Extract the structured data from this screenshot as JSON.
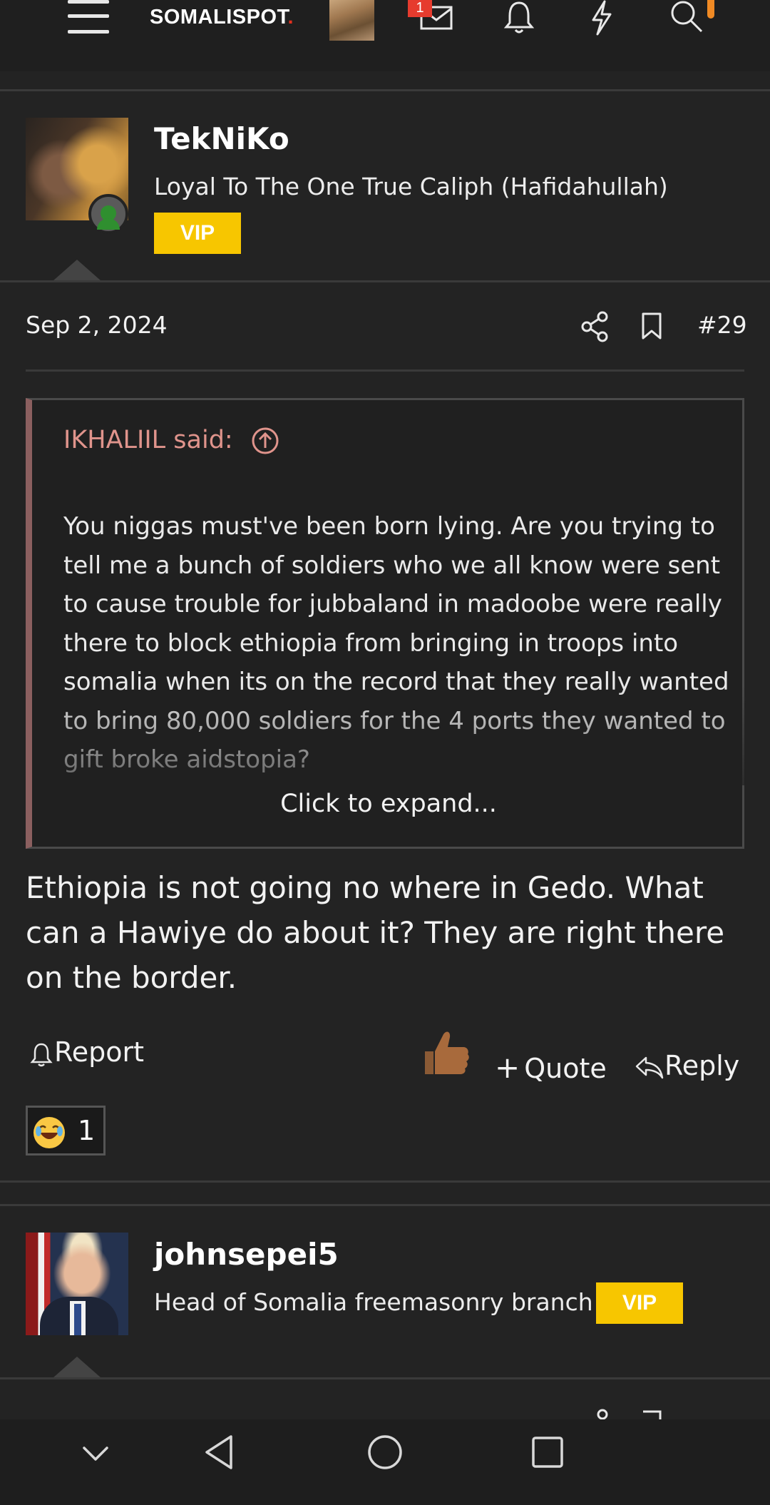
{
  "header": {
    "logo_text": "SOMALISPOT",
    "notification_badge": "1",
    "icons": [
      "menu-icon",
      "inbox-icon",
      "bell-icon",
      "lightning-icon",
      "search-icon"
    ]
  },
  "post1": {
    "username": "TekNiKo",
    "user_title": "Loyal To The One True Caliph (Hafidahullah)",
    "badge": "VIP",
    "date": "Sep 2, 2024",
    "post_number": "#29",
    "quote": {
      "author": "IKHALIIL said:",
      "text": "You niggas must've been born lying. Are you trying to tell me a bunch of soldiers who we all know were sent to cause trouble for jubbaland in madoobe were really there to block ethiopia from bringing in troops into somalia when its on the record that they really wanted to bring 80,000 soldiers for the 4 ports they wanted to gift broke aidstopia?",
      "expand_label": "Click to expand..."
    },
    "message": "Ethiopia is not going no where in Gedo. What can a Hawiye do about it? They are right there on the border.",
    "actions": {
      "report": "Report",
      "quote": "Quote",
      "reply": "Reply"
    },
    "reaction_count": "1"
  },
  "post2": {
    "username": "johnsepei5",
    "user_title": "Head of Somalia freemasonry branch",
    "badge": "VIP"
  },
  "colors": {
    "background": "#232323",
    "vip": "#f7c600",
    "quote_author": "#e0948c",
    "quote_bar": "#8b5f5f",
    "badge_red": "#e63b2e"
  }
}
